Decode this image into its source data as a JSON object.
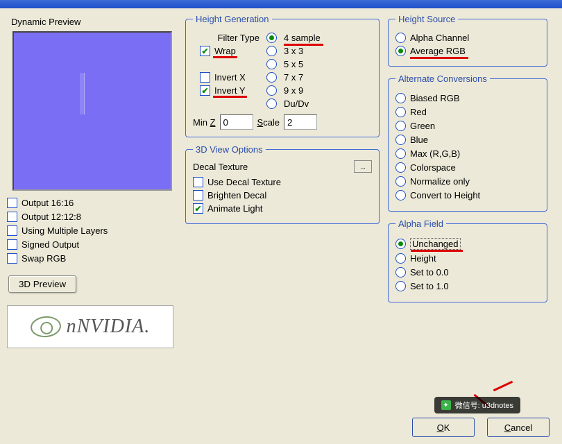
{
  "titlebar": "",
  "preview": {
    "label": "Dynamic Preview"
  },
  "output_options": {
    "out1616": "Output 16:16",
    "out12128": "Output 12:12:8",
    "multi_layers": "Using Multiple Layers",
    "signed": "Signed Output",
    "swap": "Swap RGB"
  },
  "preview3d_btn": "3D Preview",
  "nvidia": {
    "text": "NVIDIA."
  },
  "height_gen": {
    "legend": "Height Generation",
    "filter_type_label": "Filter Type",
    "samples": {
      "s4": "4 sample",
      "s3": "3 x 3",
      "s5": "5 x 5",
      "s7": "7 x 7",
      "s9": "9 x 9",
      "dudv": "Du/Dv"
    },
    "wrap": "Wrap",
    "invx": "Invert X",
    "invy": "Invert Y",
    "minz_label": "Min Z",
    "minz_value": "0",
    "scale_label": "Scale",
    "scale_value": "2"
  },
  "view3d": {
    "legend": "3D View Options",
    "decal_label": "Decal Texture",
    "use_decal": "Use Decal Texture",
    "brighten": "Brighten Decal",
    "animate": "Animate Light"
  },
  "height_src": {
    "legend": "Height Source",
    "alpha": "Alpha Channel",
    "avg": "Average RGB"
  },
  "alt_conv": {
    "legend": "Alternate Conversions",
    "biased": "Biased RGB",
    "red": "Red",
    "green": "Green",
    "blue": "Blue",
    "max": "Max (R,G,B)",
    "colorspace": "Colorspace",
    "normalize": "Normalize only",
    "convert": "Convert to Height"
  },
  "alpha_field": {
    "legend": "Alpha Field",
    "unchanged": "Unchanged",
    "height": "Height",
    "set0": "Set to 0.0",
    "set1": "Set to 1.0"
  },
  "buttons": {
    "ok": "OK",
    "cancel": "Cancel"
  },
  "watermark": "微信号: u3dnotes"
}
